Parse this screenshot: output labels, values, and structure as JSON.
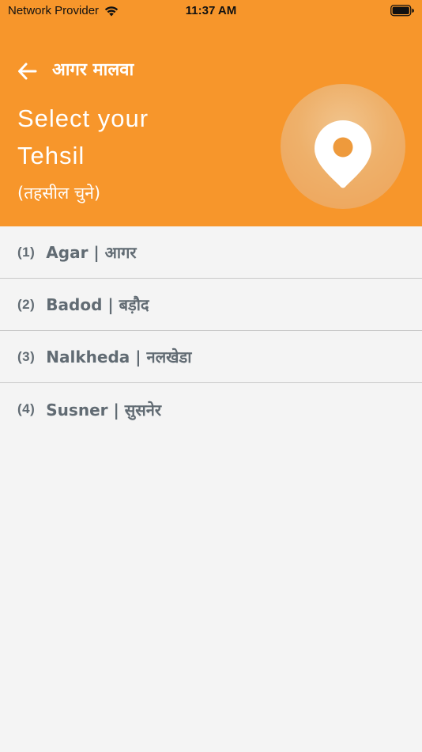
{
  "status_bar": {
    "carrier": "Network Provider",
    "time": "11:37 AM"
  },
  "header": {
    "title": "आगर मालवा",
    "heading_line1": "Select your",
    "heading_line2": "Tehsil",
    "subheading": "(तहसील चुने)",
    "back_icon": "arrow-left-icon",
    "badge_icon": "location-pin-icon"
  },
  "colors": {
    "header_bg": "#f7962b",
    "list_bg": "#f4f4f4",
    "list_text": "#616b73",
    "divider": "#c9c9c9"
  },
  "tehsils": [
    {
      "number": "(1)",
      "name": "Agar | आगर"
    },
    {
      "number": "(2)",
      "name": "Badod | बड़ौद"
    },
    {
      "number": "(3)",
      "name": "Nalkheda | नलखेडा"
    },
    {
      "number": "(4)",
      "name": "Susner | सुसनेर"
    }
  ]
}
